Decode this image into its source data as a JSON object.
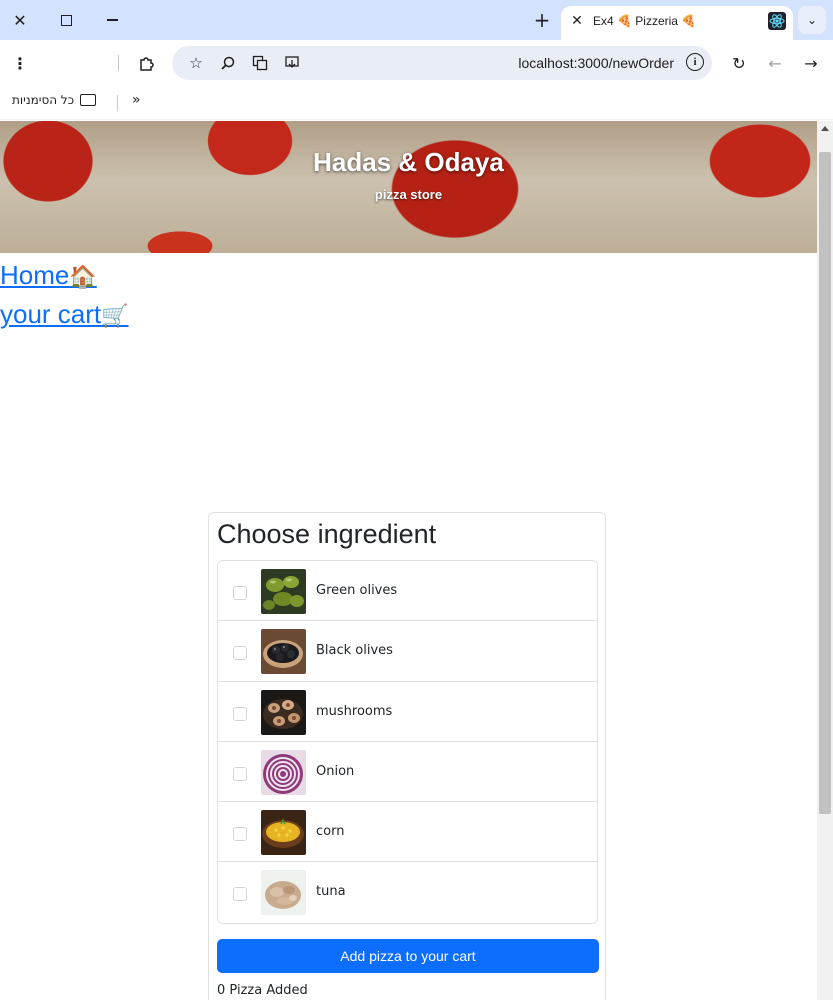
{
  "browser": {
    "tab_title": "Ex4 🍕 Pizzeria 🍕",
    "url": "localhost:3000/newOrder",
    "bookmarks_all_label": "כל הסימניות",
    "bookmarks_more": "»"
  },
  "header": {
    "title": "Hadas & Odaya",
    "subtitle": "pizza store"
  },
  "nav": {
    "home_label": "Home",
    "home_emoji": "🏠",
    "cart_label": "your cart",
    "cart_emoji": "🛒"
  },
  "order": {
    "heading": "Choose ingredient",
    "ingredients": [
      {
        "name": "Green olives",
        "checked": false,
        "icon": "green-olives-photo"
      },
      {
        "name": "Black olives",
        "checked": false,
        "icon": "black-olives-photo"
      },
      {
        "name": "mushrooms",
        "checked": false,
        "icon": "mushrooms-photo"
      },
      {
        "name": "Onion",
        "checked": false,
        "icon": "onion-photo"
      },
      {
        "name": "corn",
        "checked": false,
        "icon": "corn-photo"
      },
      {
        "name": "tuna",
        "checked": false,
        "icon": "tuna-photo"
      }
    ],
    "add_button_label": "Add pizza to your cart",
    "added_status": "0 Pizza Added"
  },
  "colors": {
    "primary": "#0d6efd",
    "tabbar": "#d3e3fd"
  }
}
